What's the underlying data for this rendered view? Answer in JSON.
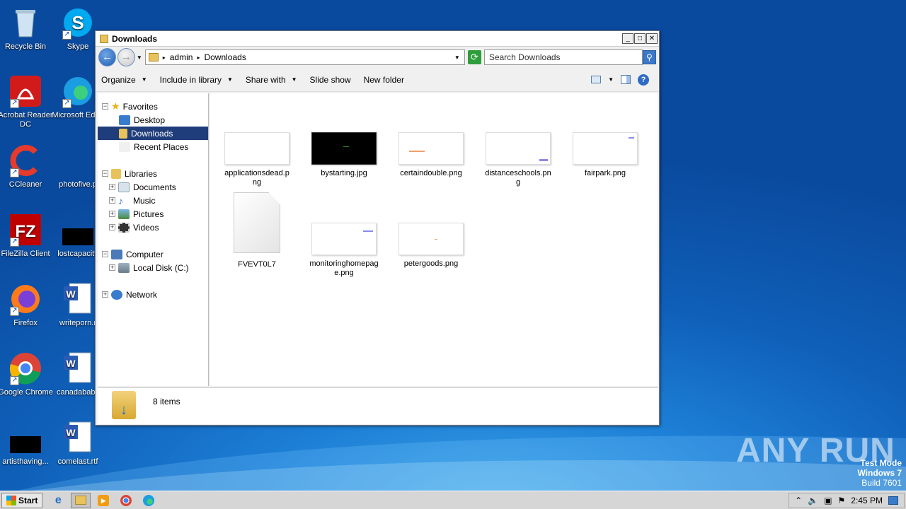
{
  "desktop": {
    "icons": [
      {
        "label": "Recycle Bin"
      },
      {
        "label": "Skype"
      },
      {
        "label": "Acrobat Reader DC"
      },
      {
        "label": "Microsoft Edge"
      },
      {
        "label": "CCleaner"
      },
      {
        "label": "photofive.p"
      },
      {
        "label": "FileZilla Client"
      },
      {
        "label": "lostcapacity"
      },
      {
        "label": "Firefox"
      },
      {
        "label": "writeporn.r"
      },
      {
        "label": "Google Chrome"
      },
      {
        "label": "canadababy"
      },
      {
        "label": "artisthaving..."
      },
      {
        "label": "comelast.rtf"
      }
    ],
    "watermark": "ANY RUN",
    "test_mode": {
      "line1": "Test Mode",
      "line2": "Windows 7",
      "line3": "Build 7601"
    }
  },
  "window": {
    "title": "Downloads",
    "address": {
      "root": "admin",
      "current": "Downloads"
    },
    "search_placeholder": "Search Downloads",
    "toolbar": {
      "organize": "Organize",
      "include": "Include in library",
      "share": "Share with",
      "slideshow": "Slide show",
      "newfolder": "New folder"
    },
    "nav": {
      "favorites": "Favorites",
      "desktop": "Desktop",
      "downloads": "Downloads",
      "recent": "Recent Places",
      "libraries": "Libraries",
      "documents": "Documents",
      "music": "Music",
      "pictures": "Pictures",
      "videos": "Videos",
      "computer": "Computer",
      "localdisk": "Local Disk (C:)",
      "network": "Network"
    },
    "files": [
      {
        "name": "applicationsdead.png",
        "line1": "applicationsdead.p",
        "line2": "ng"
      },
      {
        "name": "bystarting.jpg",
        "line1": "bystarting.jpg",
        "line2": ""
      },
      {
        "name": "certaindouble.png",
        "line1": "certaindouble.png",
        "line2": ""
      },
      {
        "name": "distanceschools.png",
        "line1": "distanceschools.pn",
        "line2": "g"
      },
      {
        "name": "fairpark.png",
        "line1": "fairpark.png",
        "line2": ""
      },
      {
        "name": "FVEVT0L7",
        "line1": "FVEVT0L7",
        "line2": ""
      },
      {
        "name": "monitoringhomepage.png",
        "line1": "monitoringhomepag",
        "line2": "e.png"
      },
      {
        "name": "petergoods.png",
        "line1": "petergoods.png",
        "line2": ""
      }
    ],
    "status": "8 items"
  },
  "taskbar": {
    "start": "Start",
    "time": "2:45 PM"
  }
}
